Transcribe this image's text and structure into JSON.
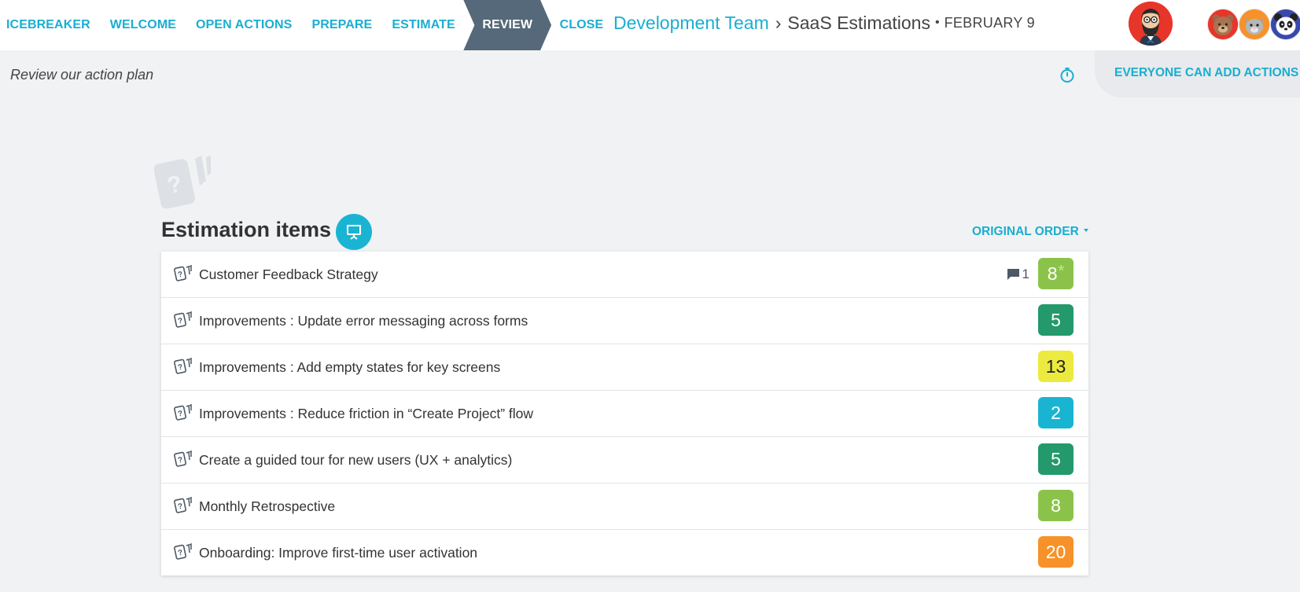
{
  "nav": {
    "steps": [
      "ICEBREAKER",
      "WELCOME",
      "OPEN ACTIONS",
      "PREPARE",
      "ESTIMATE",
      "REVIEW",
      "CLOSE"
    ],
    "active": "REVIEW"
  },
  "breadcrumb": {
    "team": "Development Team",
    "separator": "›",
    "session": "SaaS Estimations",
    "dot": "•",
    "date": "FEBRUARY 9"
  },
  "subbar": {
    "subtitle": "Review our action plan",
    "permission_label": "EVERYONE CAN ADD ACTIONS"
  },
  "section": {
    "title": "Estimation items",
    "order_label": "ORIGINAL ORDER"
  },
  "items": [
    {
      "label": "Customer Feedback Strategy",
      "value": "8",
      "starred": true,
      "comments": "1",
      "color": "#8bc34a"
    },
    {
      "label": "Improvements : Update error messaging across forms",
      "value": "5",
      "starred": false,
      "comments": null,
      "color": "#24996b"
    },
    {
      "label": "Improvements : Add empty states for key screens",
      "value": "13",
      "starred": false,
      "comments": null,
      "color": "#ecea3e"
    },
    {
      "label": "Improvements : Reduce friction in “Create Project” flow",
      "value": "2",
      "starred": false,
      "comments": null,
      "color": "#1ab4d3"
    },
    {
      "label": "Create a guided tour for new users (UX + analytics)",
      "value": "5",
      "starred": false,
      "comments": null,
      "color": "#24996b"
    },
    {
      "label": "Monthly Retrospective",
      "value": "8",
      "starred": false,
      "comments": null,
      "color": "#8bc34a"
    },
    {
      "label": "Onboarding: Improve first-time user activation",
      "value": "20",
      "starred": false,
      "comments": null,
      "color": "#f7922a"
    }
  ],
  "colors": {
    "accent": "#1aaed0",
    "active_step": "#55697a"
  },
  "icons": [
    "stopwatch-icon",
    "present-icon",
    "card-question-icon",
    "comment-icon",
    "chevron-down-icon"
  ],
  "users": [
    "bearded-man-avatar",
    "bear-avatar",
    "cat-avatar",
    "panda-avatar"
  ]
}
